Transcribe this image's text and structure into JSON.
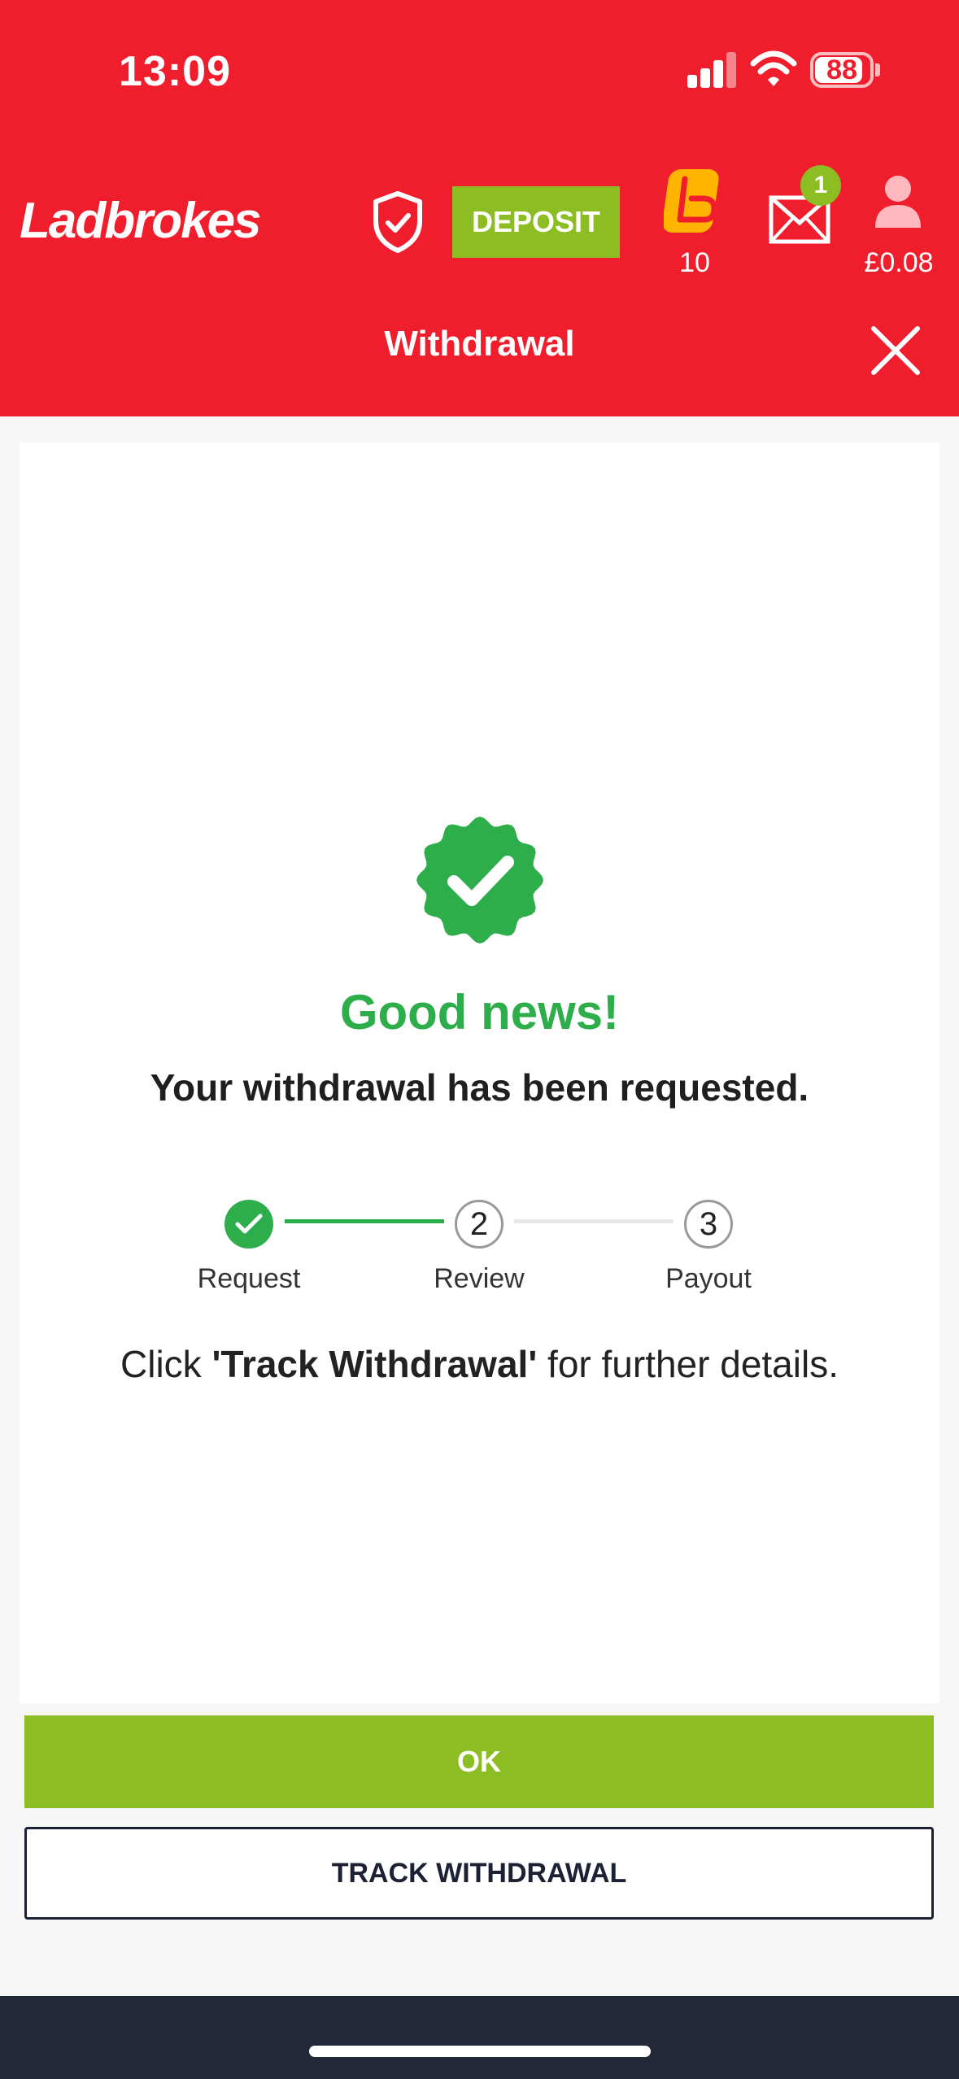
{
  "status_bar": {
    "time": "13:09",
    "battery": "88",
    "battery_level_percent": 88
  },
  "header": {
    "logo_text": "Ladbrokes",
    "deposit_label": "DEPOSIT",
    "loyalty_count": "10",
    "mail_badge": "1",
    "balance": "£0.08",
    "title": "Withdrawal"
  },
  "content": {
    "headline": "Good news!",
    "subtitle": "Your withdrawal has been requested.",
    "steps": [
      {
        "number": "1",
        "label": "Request",
        "state": "done"
      },
      {
        "number": "2",
        "label": "Review",
        "state": "pending"
      },
      {
        "number": "3",
        "label": "Payout",
        "state": "pending"
      }
    ],
    "details_prefix": "Click ",
    "details_bold": "'Track Withdrawal'",
    "details_suffix": " for further details."
  },
  "actions": {
    "ok_label": "OK",
    "track_label": "TRACK WITHDRAWAL"
  },
  "colors": {
    "brand_red": "#f01e2c",
    "accent_green": "#8cbd22",
    "success_green": "#2eae4b",
    "dark_navy": "#1c2133"
  },
  "icons": [
    "signal-icon",
    "wifi-icon",
    "battery-icon",
    "shield-check-icon",
    "lb-loyalty-icon",
    "mail-icon",
    "user-icon",
    "close-icon",
    "check-badge-icon",
    "check-icon"
  ]
}
